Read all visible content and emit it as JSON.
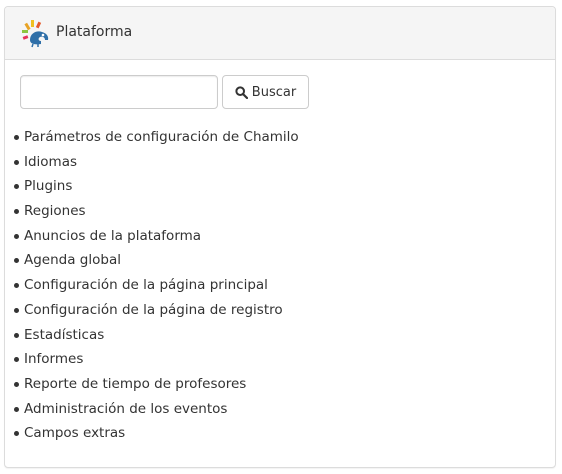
{
  "panel": {
    "title": "Plataforma"
  },
  "search": {
    "value": "",
    "button_label": "Buscar"
  },
  "menu": {
    "items": [
      {
        "label": "Parámetros de configuración de Chamilo"
      },
      {
        "label": "Idiomas"
      },
      {
        "label": "Plugins"
      },
      {
        "label": "Regiones"
      },
      {
        "label": "Anuncios de la plataforma"
      },
      {
        "label": "Agenda global"
      },
      {
        "label": "Configuración de la página principal"
      },
      {
        "label": "Configuración de la página de registro"
      },
      {
        "label": "Estadísticas"
      },
      {
        "label": "Informes"
      },
      {
        "label": "Reporte de tiempo de profesores"
      },
      {
        "label": "Administración de los eventos"
      },
      {
        "label": "Campos extras"
      }
    ]
  },
  "icons": {
    "logo": "chamilo-logo-icon",
    "search": "search-icon"
  }
}
